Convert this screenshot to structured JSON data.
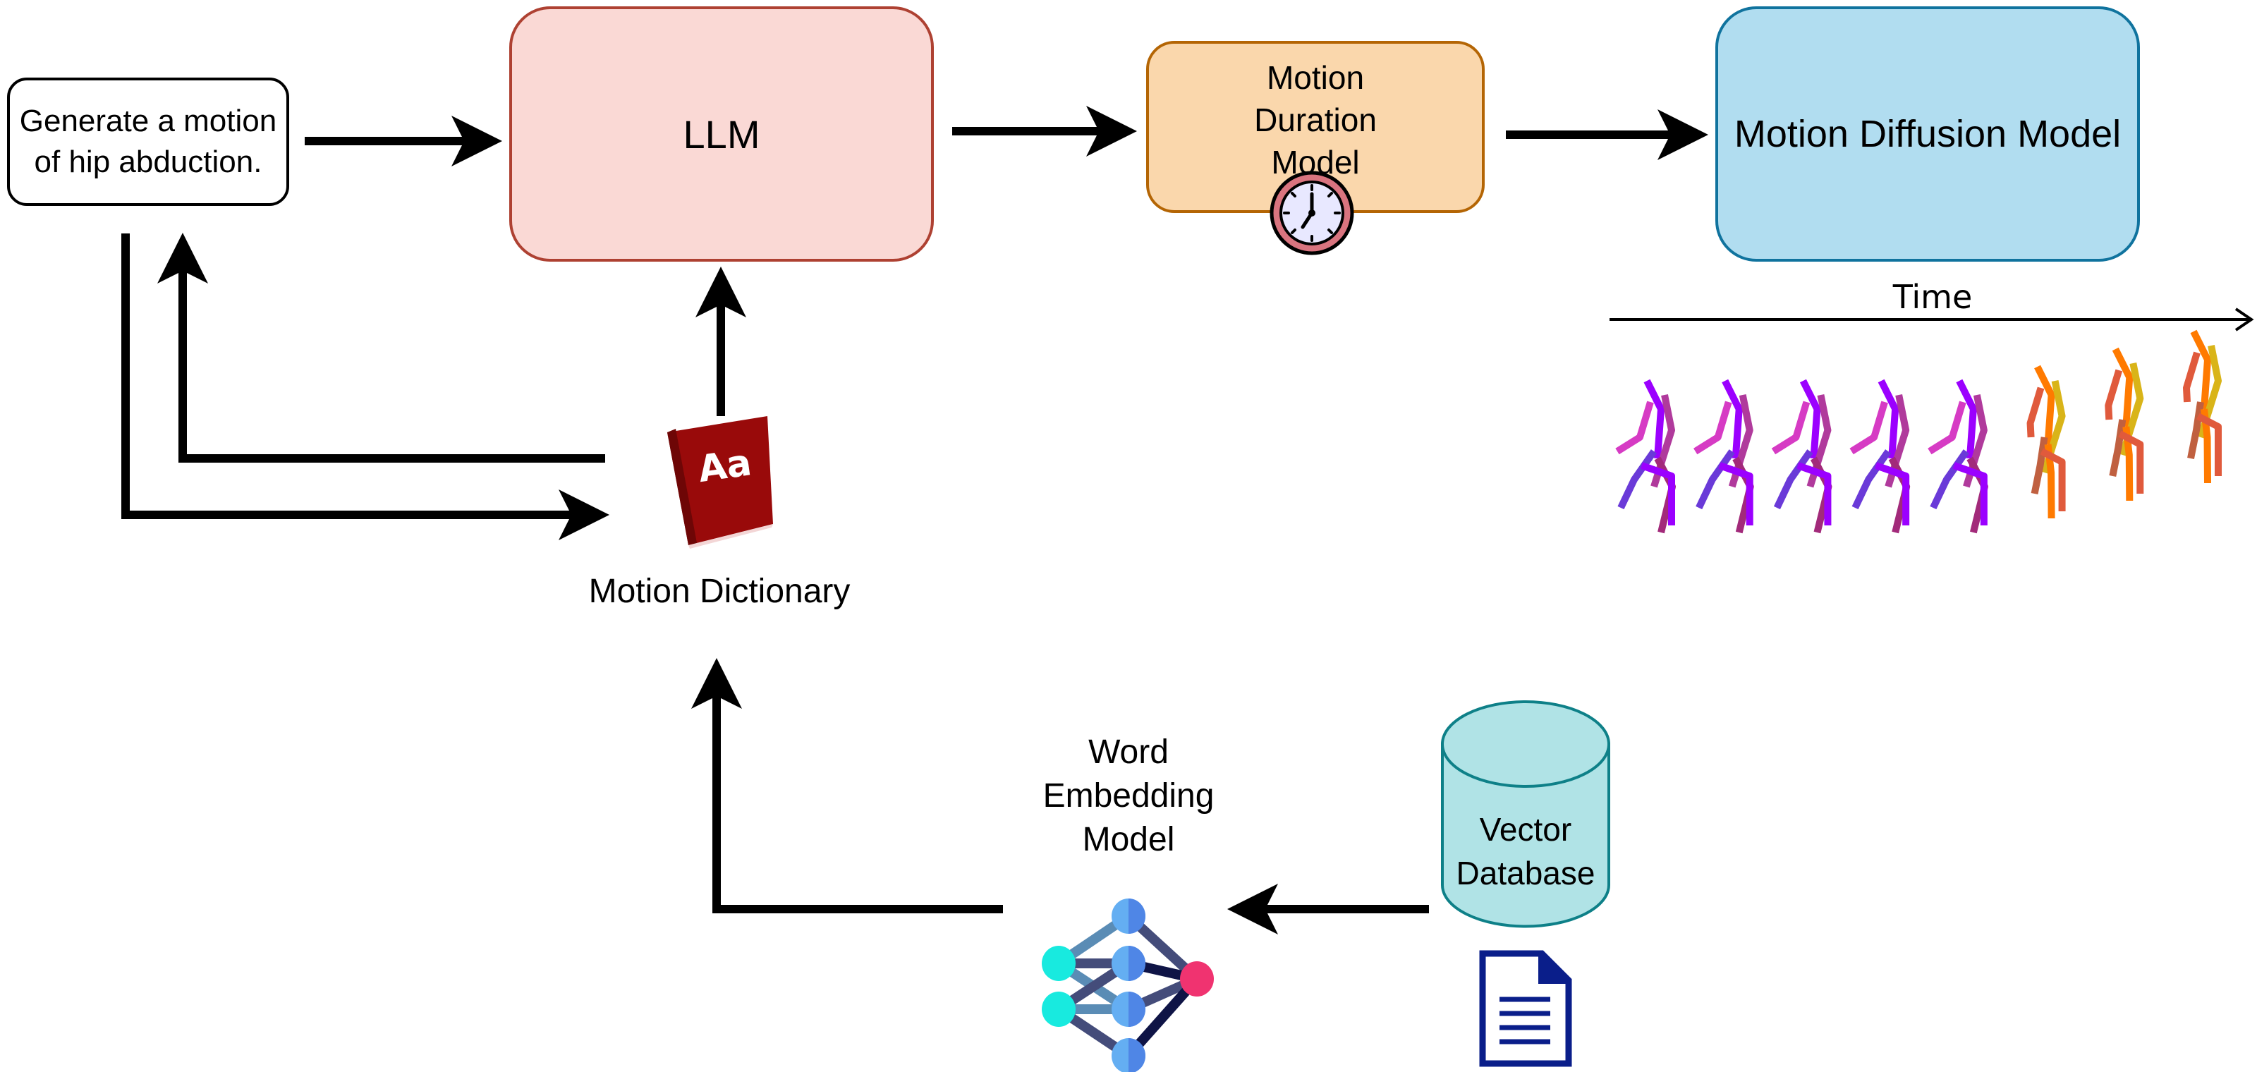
{
  "diagram": {
    "nodes": {
      "prompt": {
        "text": "Generate a motion of hip abduction."
      },
      "llm": {
        "text": "LLM"
      },
      "duration_model": {
        "text": "Motion Duration Model"
      },
      "diffusion_model": {
        "text": "Motion Diffusion Model"
      },
      "motion_dictionary": {
        "text": "Motion Dictionary",
        "icon_text": "Aa"
      },
      "word_embedding": {
        "text": "Word Embedding Model"
      },
      "vector_database": {
        "text": "Vector Database"
      }
    },
    "time_axis": {
      "label": "Time"
    },
    "motion_frames": {
      "count": 8
    },
    "colors": {
      "llm_fill": "#fad9d5",
      "llm_stroke": "#ae4132",
      "duration_fill": "#fad7ac",
      "duration_stroke": "#b46504",
      "diffusion_fill": "#b1ddf0",
      "diffusion_stroke": "#10739e",
      "database_fill": "#b0e3e6",
      "database_stroke": "#0e8088",
      "book": "#990a0a",
      "document": "#0a1e8a"
    },
    "edges": [
      {
        "from": "prompt",
        "to": "llm"
      },
      {
        "from": "llm",
        "to": "duration_model"
      },
      {
        "from": "duration_model",
        "to": "diffusion_model"
      },
      {
        "from": "prompt",
        "to": "motion_dictionary"
      },
      {
        "from": "motion_dictionary",
        "to": "prompt"
      },
      {
        "from": "motion_dictionary",
        "to": "llm"
      },
      {
        "from": "vector_database",
        "to": "word_embedding"
      },
      {
        "from": "word_embedding",
        "to": "motion_dictionary"
      }
    ]
  }
}
